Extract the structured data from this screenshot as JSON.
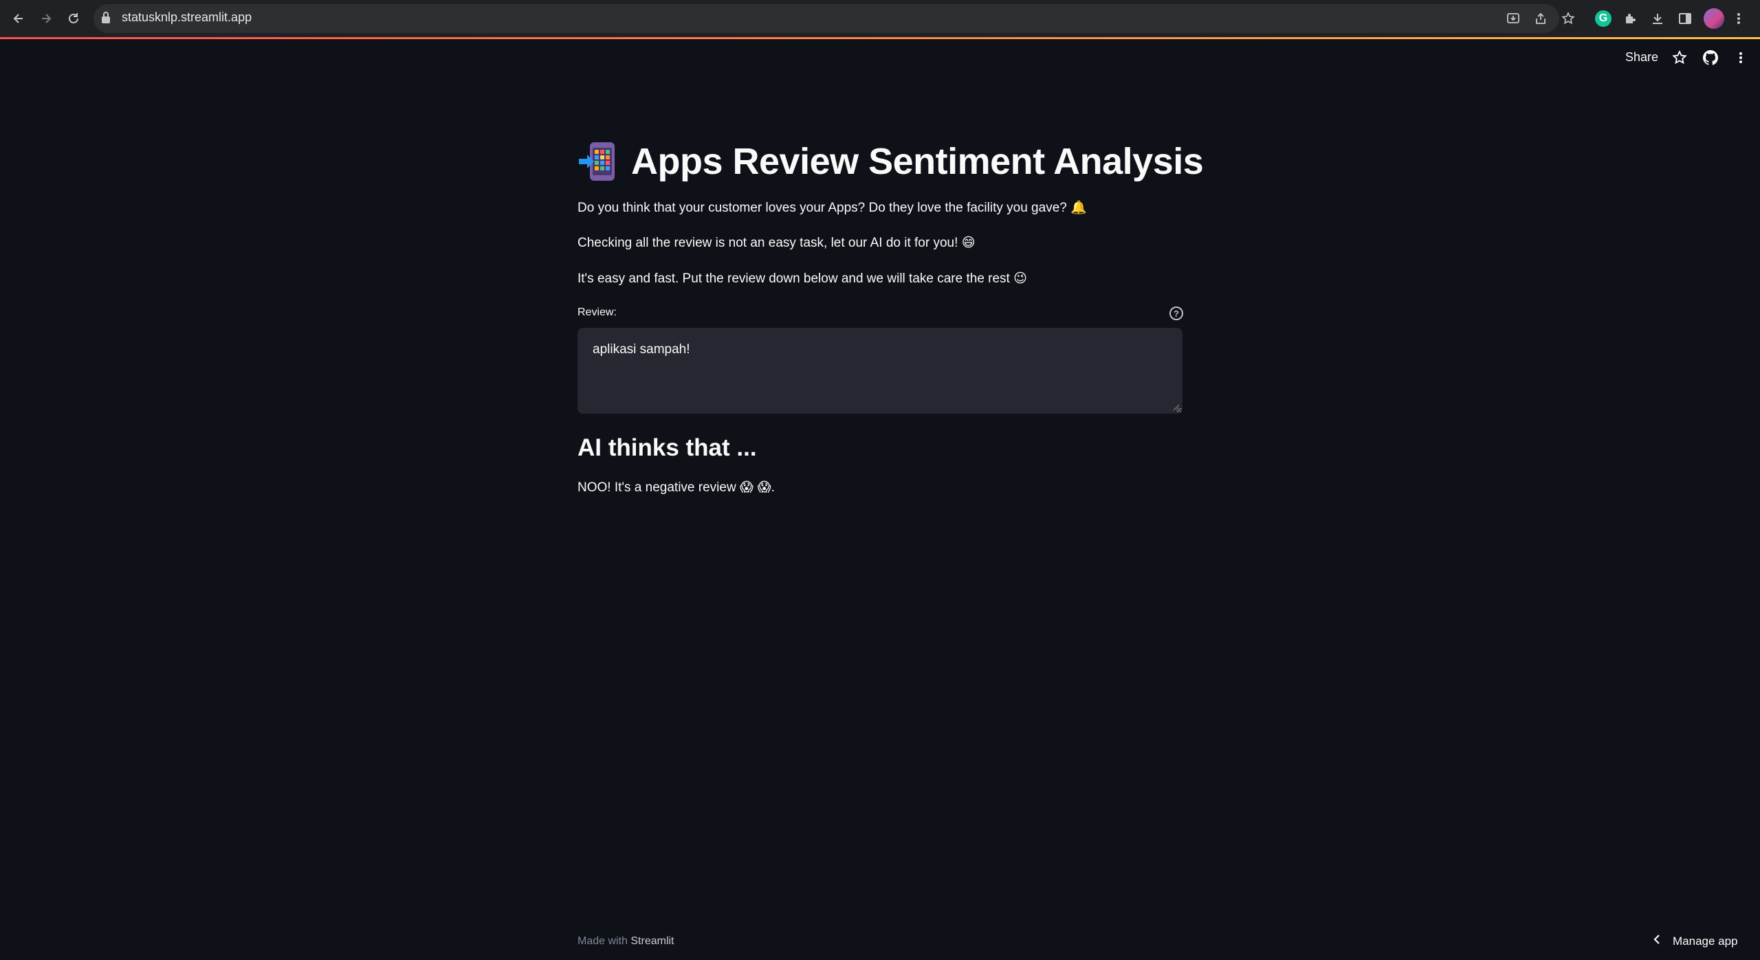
{
  "browser": {
    "url": "statusknlp.streamlit.app",
    "icons": [
      "back-icon",
      "forward-icon",
      "reload-icon",
      "lock-icon",
      "install-app-icon",
      "share-page-icon",
      "bookmark-star-icon",
      "grammarly-icon",
      "extensions-icon",
      "downloads-icon",
      "side-panel-icon",
      "profile-avatar",
      "browser-menu-icon"
    ],
    "grammarly_letter": "G"
  },
  "app_header": {
    "share_label": "Share",
    "icons": [
      "star-icon",
      "github-icon",
      "more-vertical-icon"
    ]
  },
  "main": {
    "title": "Apps Review Sentiment Analysis",
    "title_emoji": "mobile-phone-arrow-emoji",
    "paragraphs": [
      {
        "text": "Do you think that your customer loves your Apps? Do they love the facility you gave?",
        "emoji": "🔔"
      },
      {
        "text": "Checking all the review is not an easy task, let our AI do it for you!",
        "emoji": "😄"
      },
      {
        "text": "It's easy and fast. Put the review down below and we will take care the rest",
        "emoji": "😉"
      }
    ],
    "review_label": "Review:",
    "help_glyph": "?",
    "review_value": "aplikasi sampah!",
    "result_heading": "AI thinks that ...",
    "result_text": "NOO! It's a negative review",
    "result_emojis": "😱 😱",
    "result_suffix": "."
  },
  "footer": {
    "made_with": "Made with",
    "brand": "Streamlit",
    "manage_app": "Manage app"
  },
  "colors": {
    "background": "#0e1117",
    "chrome": "#202124",
    "textarea_bg": "#262730",
    "accent_red": "#ff4b4b",
    "accent_yellow": "#ffbd45"
  }
}
